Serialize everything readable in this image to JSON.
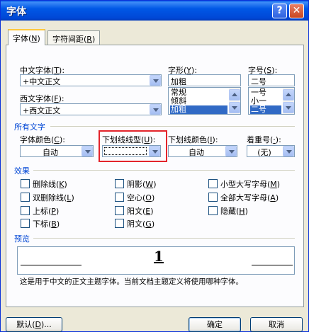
{
  "window": {
    "title": "字体",
    "help_glyph": "?",
    "close_glyph": "✕"
  },
  "tabs": [
    {
      "label": "字体",
      "key": "N"
    },
    {
      "label": "字符间距",
      "key": "R"
    }
  ],
  "font": {
    "chinese_label": "中文字体",
    "chinese_key": "T",
    "chinese_value": "+中文正文",
    "western_label": "西文字体",
    "western_key": "F",
    "western_value": "+西文正文",
    "style_label": "字形",
    "style_key": "Y",
    "style_value": "加粗",
    "style_options": [
      "常规",
      "倾斜",
      "加粗"
    ],
    "style_selected_index": 2,
    "size_label": "字号",
    "size_key": "S",
    "size_value": "二号",
    "size_options": [
      "一号",
      "小一",
      "二号"
    ],
    "size_selected_index": 2
  },
  "all_text": {
    "section_title": "所有文字",
    "color_label": "字体颜色",
    "color_key": "C",
    "color_value": "自动",
    "underline_label": "下划线线型",
    "underline_key": "U",
    "underline_value": "",
    "underline_color_label": "下划线颜色",
    "underline_color_key": "I",
    "underline_color_value": "自动",
    "emphasis_label": "着重号",
    "emphasis_key": "·",
    "emphasis_value": "(无)"
  },
  "effects": {
    "section_title": "效果",
    "items": [
      {
        "label": "删除线",
        "key": "K",
        "checked": false
      },
      {
        "label": "阴影",
        "key": "W",
        "checked": false
      },
      {
        "label": "小型大写字母",
        "key": "M",
        "checked": false
      },
      {
        "label": "双删除线",
        "key": "L",
        "checked": false
      },
      {
        "label": "空心",
        "key": "O",
        "checked": false
      },
      {
        "label": "全部大写字母",
        "key": "A",
        "checked": false
      },
      {
        "label": "上标",
        "key": "P",
        "checked": false
      },
      {
        "label": "阳文",
        "key": "E",
        "checked": false
      },
      {
        "label": "隐藏",
        "key": "H",
        "checked": false
      },
      {
        "label": "下标",
        "key": "B",
        "checked": false
      },
      {
        "label": "阴文",
        "key": "G",
        "checked": false
      }
    ]
  },
  "preview": {
    "section_title": "预览",
    "sample_text": "1",
    "description": "这是用于中文的正文主题字体。当前文档主题定义将使用哪种字体。"
  },
  "buttons": {
    "default_label": "默认",
    "default_key": "D",
    "default_suffix": "...",
    "ok_label": "确定",
    "cancel_label": "取消"
  },
  "colors": {
    "title_bar": "#0054e3",
    "highlight": "#316ac5",
    "group_title": "#0046d5",
    "callout": "#e3242b"
  }
}
